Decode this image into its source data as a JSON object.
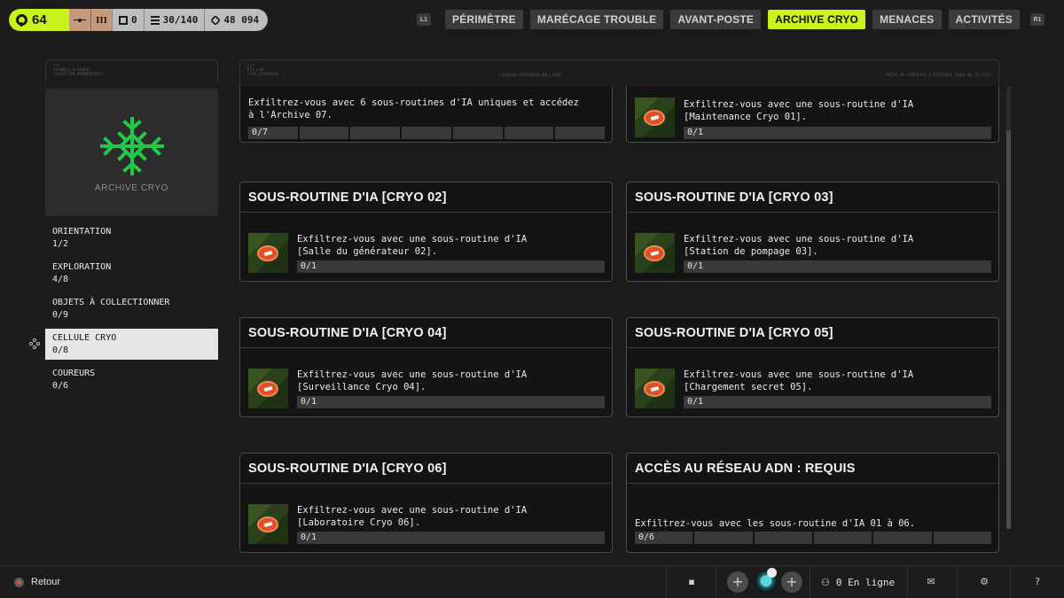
{
  "stats": {
    "level": "64",
    "tier": "III",
    "s1": "0",
    "s2": "30/140",
    "s3": "48 094"
  },
  "tabs": {
    "left_bumper": "L1",
    "right_bumper": "R1",
    "items": [
      "PÉRIMÈTRE",
      "MARÉCAGE TROUBLE",
      "AVANT-POSTE",
      "ARCHIVE CRYO",
      "MENACES",
      "ACTIVITÉS"
    ],
    "active_index": 3
  },
  "left": {
    "micro_l1": "SIGNALS_ALIGNED",
    "micro_l2": "[POSITION_HARMONIZED]",
    "emblem_label": "ARCHIVE CRYO",
    "categories": [
      {
        "name": "ORIENTATION",
        "value": "1/2"
      },
      {
        "name": "EXPLORATION",
        "value": "4/8"
      },
      {
        "name": "OBJETS À COLLECTIONNER",
        "value": "0/9"
      },
      {
        "name": "CELLULE CRYO",
        "value": "0/8"
      },
      {
        "name": "COUREURS",
        "value": "0/6"
      }
    ]
  },
  "main": {
    "micro_l1": "ETS_LOG",
    "micro_l2": "SYNC_APPROVED",
    "micro_c": "LIAISON_TERMINAUX_EN_LIGNE",
    "micro_r": "POSTE DE CONTROLE À DISTANCE SEUR 00.15.2157",
    "cards": [
      {
        "title": "",
        "desc": "Exfiltrez-vous avec 6 sous-routines d'IA uniques et accédez\nà l'Archive 07.",
        "progress": "0/7",
        "segments": 7,
        "thumb": false
      },
      {
        "title": "",
        "desc": "Exfiltrez-vous avec une sous-routine d'IA\n[Maintenance Cryo 01].",
        "progress": "0/1",
        "segments": 1,
        "thumb": true
      },
      {
        "title": "SOUS-ROUTINE D'IA [CRYO 02]",
        "desc": "Exfiltrez-vous avec une sous-routine d'IA\n[Salle du générateur 02].",
        "progress": "0/1",
        "segments": 1,
        "thumb": true
      },
      {
        "title": "SOUS-ROUTINE D'IA [CRYO 03]",
        "desc": "Exfiltrez-vous avec une sous-routine d'IA\n[Station de pompage 03].",
        "progress": "0/1",
        "segments": 1,
        "thumb": true
      },
      {
        "title": "SOUS-ROUTINE D'IA [CRYO 04]",
        "desc": "Exfiltrez-vous avec une sous-routine d'IA\n[Surveillance Cryo 04].",
        "progress": "0/1",
        "segments": 1,
        "thumb": true
      },
      {
        "title": "SOUS-ROUTINE D'IA [CRYO 05]",
        "desc": "Exfiltrez-vous avec une sous-routine d'IA\n[Chargement secret 05].",
        "progress": "0/1",
        "segments": 1,
        "thumb": true
      },
      {
        "title": "SOUS-ROUTINE D'IA [CRYO 06]",
        "desc": "Exfiltrez-vous avec une sous-routine d'IA\n[Laboratoire Cryo 06].",
        "progress": "0/1",
        "segments": 1,
        "thumb": true
      },
      {
        "title": "ACCÈS AU RÉSEAU ADN : REQUIS",
        "desc": "Exfiltrez-vous avec les sous-routine d'IA 01 à 06.",
        "progress": "0/6",
        "segments": 6,
        "thumb": false
      }
    ]
  },
  "bottom": {
    "back_label": "Retour",
    "online_label": "0 En ligne",
    "help_label": "?"
  },
  "colors": {
    "accent": "#c9f31d",
    "emblem": "#22c84a",
    "chip": "#de4f26"
  }
}
